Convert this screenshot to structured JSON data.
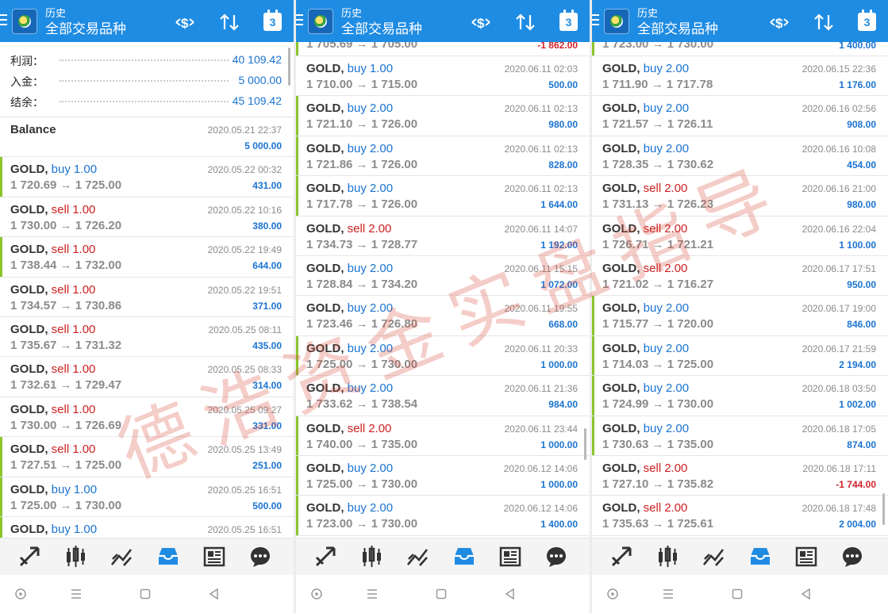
{
  "panels": [
    {
      "header": {
        "title": "历史",
        "subtitle": "全部交易品种",
        "calendar_day": "3"
      },
      "summary": [
        {
          "label": "利润：",
          "value": "40 109.42"
        },
        {
          "label": "入金：",
          "value": "5 000.00"
        },
        {
          "label": "结余：",
          "value": "45 109.42"
        }
      ],
      "balance": {
        "label": "Balance",
        "time": "2020.05.21 22:37",
        "value": "5 000.00"
      },
      "trades": [
        {
          "symbol": "GOLD,",
          "side": "buy",
          "lot": "1.00",
          "price": "1 720.69 → 1 725.00",
          "time": "2020.05.22 00:32",
          "profit": "431.00",
          "mark": true
        },
        {
          "symbol": "GOLD,",
          "side": "sell",
          "lot": "1.00",
          "price": "1 730.00 → 1 726.20",
          "time": "2020.05.22 10:16",
          "profit": "380.00",
          "mark": false
        },
        {
          "symbol": "GOLD,",
          "side": "sell",
          "lot": "1.00",
          "price": "1 738.44 → 1 732.00",
          "time": "2020.05.22 19:49",
          "profit": "644.00",
          "mark": true
        },
        {
          "symbol": "GOLD,",
          "side": "sell",
          "lot": "1.00",
          "price": "1 734.57 → 1 730.86",
          "time": "2020.05.22 19:51",
          "profit": "371.00",
          "mark": false
        },
        {
          "symbol": "GOLD,",
          "side": "sell",
          "lot": "1.00",
          "price": "1 735.67 → 1 731.32",
          "time": "2020.05.25 08:11",
          "profit": "435.00",
          "mark": false
        },
        {
          "symbol": "GOLD,",
          "side": "sell",
          "lot": "1.00",
          "price": "1 732.61 → 1 729.47",
          "time": "2020.05.25 08:33",
          "profit": "314.00",
          "mark": false
        },
        {
          "symbol": "GOLD,",
          "side": "sell",
          "lot": "1.00",
          "price": "1 730.00 → 1 726.69",
          "time": "2020.05.25 09:27",
          "profit": "331.00",
          "mark": false
        },
        {
          "symbol": "GOLD,",
          "side": "sell",
          "lot": "1.00",
          "price": "1 727.51 → 1 725.00",
          "time": "2020.05.25 13:49",
          "profit": "251.00",
          "mark": true
        },
        {
          "symbol": "GOLD,",
          "side": "buy",
          "lot": "1.00",
          "price": "1 725.00 → 1 730.00",
          "time": "2020.05.25 16:51",
          "profit": "500.00",
          "mark": true
        },
        {
          "symbol": "GOLD,",
          "side": "buy",
          "lot": "1.00",
          "price": "",
          "time": "2020.05.25 16:51",
          "profit": "",
          "mark": true
        }
      ]
    },
    {
      "header": {
        "title": "历史",
        "subtitle": "全部交易品种",
        "calendar_day": "3"
      },
      "partial_top": {
        "price": "1 705.69 → 1 705.00",
        "profit": "-1 862.00"
      },
      "trades": [
        {
          "symbol": "GOLD,",
          "side": "buy",
          "lot": "1.00",
          "price": "1 710.00 → 1 715.00",
          "time": "2020.06.11 02:03",
          "profit": "500.00",
          "mark": false
        },
        {
          "symbol": "GOLD,",
          "side": "buy",
          "lot": "2.00",
          "price": "1 721.10 → 1 726.00",
          "time": "2020.06.11 02:13",
          "profit": "980.00",
          "mark": true
        },
        {
          "symbol": "GOLD,",
          "side": "buy",
          "lot": "2.00",
          "price": "1 721.86 → 1 726.00",
          "time": "2020.06.11 02:13",
          "profit": "828.00",
          "mark": true
        },
        {
          "symbol": "GOLD,",
          "side": "buy",
          "lot": "2.00",
          "price": "1 717.78 → 1 726.00",
          "time": "2020.06.11 02:13",
          "profit": "1 644.00",
          "mark": true
        },
        {
          "symbol": "GOLD,",
          "side": "sell",
          "lot": "2.00",
          "price": "1 734.73 → 1 728.77",
          "time": "2020.06.11 14:07",
          "profit": "1 192.00",
          "mark": false
        },
        {
          "symbol": "GOLD,",
          "side": "buy",
          "lot": "2.00",
          "price": "1 728.84 → 1 734.20",
          "time": "2020.06.11 15:15",
          "profit": "1 072.00",
          "mark": false
        },
        {
          "symbol": "GOLD,",
          "side": "buy",
          "lot": "2.00",
          "price": "1 723.46 → 1 726.80",
          "time": "2020.06.11 19:55",
          "profit": "668.00",
          "mark": false
        },
        {
          "symbol": "GOLD,",
          "side": "buy",
          "lot": "2.00",
          "price": "1 725.00 → 1 730.00",
          "time": "2020.06.11 20:33",
          "profit": "1 000.00",
          "mark": true
        },
        {
          "symbol": "GOLD,",
          "side": "buy",
          "lot": "2.00",
          "price": "1 733.62 → 1 738.54",
          "time": "2020.06.11 21:36",
          "profit": "984.00",
          "mark": false
        },
        {
          "symbol": "GOLD,",
          "side": "sell",
          "lot": "2.00",
          "price": "1 740.00 → 1 735.00",
          "time": "2020.06.11 23:44",
          "profit": "1 000.00",
          "mark": true
        },
        {
          "symbol": "GOLD,",
          "side": "buy",
          "lot": "2.00",
          "price": "1 725.00 → 1 730.00",
          "time": "2020.06.12 14:06",
          "profit": "1 000.00",
          "mark": true
        },
        {
          "symbol": "GOLD,",
          "side": "buy",
          "lot": "2.00",
          "price": "1 723.00 → 1 730.00",
          "time": "2020.06.12 14:06",
          "profit": "1 400.00",
          "mark": true
        }
      ]
    },
    {
      "header": {
        "title": "历史",
        "subtitle": "全部交易品种",
        "calendar_day": "3"
      },
      "partial_top": {
        "price": "1 723.00 → 1 730.00",
        "profit": "1 400.00"
      },
      "trades": [
        {
          "symbol": "GOLD,",
          "side": "buy",
          "lot": "2.00",
          "price": "1 711.90 → 1 717.78",
          "time": "2020.06.15 22:36",
          "profit": "1 176.00",
          "mark": false
        },
        {
          "symbol": "GOLD,",
          "side": "buy",
          "lot": "2.00",
          "price": "1 721.57 → 1 726.11",
          "time": "2020.06.16 02:56",
          "profit": "908.00",
          "mark": false
        },
        {
          "symbol": "GOLD,",
          "side": "buy",
          "lot": "2.00",
          "price": "1 728.35 → 1 730.62",
          "time": "2020.06.16 10:08",
          "profit": "454.00",
          "mark": false
        },
        {
          "symbol": "GOLD,",
          "side": "sell",
          "lot": "2.00",
          "price": "1 731.13 → 1 726.23",
          "time": "2020.06.16 21:00",
          "profit": "980.00",
          "mark": false
        },
        {
          "symbol": "GOLD,",
          "side": "sell",
          "lot": "2.00",
          "price": "1 726.71 → 1 721.21",
          "time": "2020.06.16 22:04",
          "profit": "1 100.00",
          "mark": false
        },
        {
          "symbol": "GOLD,",
          "side": "sell",
          "lot": "2.00",
          "price": "1 721.02 → 1 716.27",
          "time": "2020.06.17 17:51",
          "profit": "950.00",
          "mark": false
        },
        {
          "symbol": "GOLD,",
          "side": "buy",
          "lot": "2.00",
          "price": "1 715.77 → 1 720.00",
          "time": "2020.06.17 19:00",
          "profit": "846.00",
          "mark": true
        },
        {
          "symbol": "GOLD,",
          "side": "buy",
          "lot": "2.00",
          "price": "1 714.03 → 1 725.00",
          "time": "2020.06.17 21:59",
          "profit": "2 194.00",
          "mark": true
        },
        {
          "symbol": "GOLD,",
          "side": "buy",
          "lot": "2.00",
          "price": "1 724.99 → 1 730.00",
          "time": "2020.06.18 03:50",
          "profit": "1 002.00",
          "mark": true
        },
        {
          "symbol": "GOLD,",
          "side": "buy",
          "lot": "2.00",
          "price": "1 730.63 → 1 735.00",
          "time": "2020.06.18 17:05",
          "profit": "874.00",
          "mark": true
        },
        {
          "symbol": "GOLD,",
          "side": "sell",
          "lot": "2.00",
          "price": "1 727.10 → 1 735.82",
          "time": "2020.06.18 17:11",
          "profit": "-1 744.00",
          "mark": false
        },
        {
          "symbol": "GOLD,",
          "side": "sell",
          "lot": "2.00",
          "price": "1 735.63 → 1 725.61",
          "time": "2020.06.18 17:48",
          "profit": "2 004.00",
          "mark": false
        }
      ]
    }
  ],
  "tabs": [
    "quotes-icon",
    "chart-icon",
    "trade-icon",
    "history-icon",
    "news-icon",
    "chat-icon"
  ],
  "watermark_text": "德浩资金实盘指导",
  "colors": {
    "header": "#1f8ce3",
    "buy": "#1a73d1",
    "sell": "#cc2020",
    "mark": "#8ac52c",
    "active_tab": "#1f8ce3"
  }
}
